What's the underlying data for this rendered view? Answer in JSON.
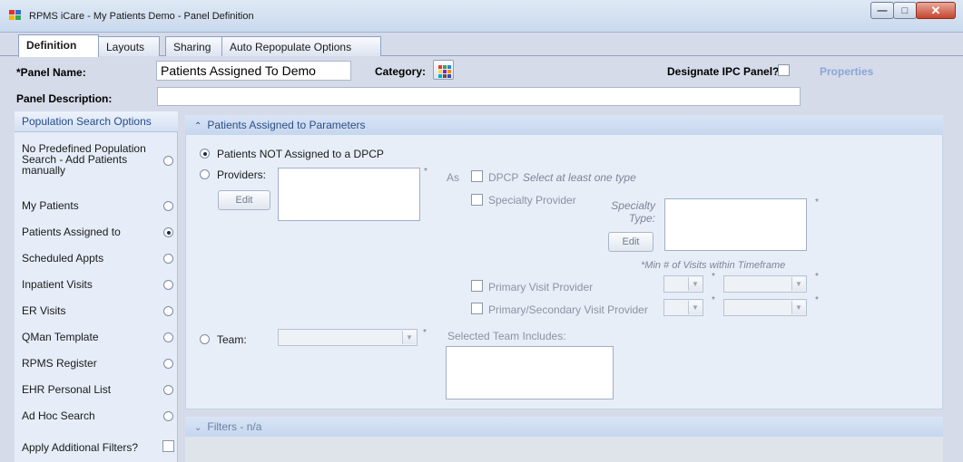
{
  "window": {
    "title": "RPMS iCare - My Patients Demo - Panel Definition",
    "min_glyph": "—",
    "max_glyph": "□",
    "close_glyph": "✕"
  },
  "tabs": [
    {
      "label": "Definition",
      "active": true
    },
    {
      "label": "Layouts"
    },
    {
      "label": "Sharing"
    },
    {
      "label": "Auto Repopulate Options"
    }
  ],
  "panel": {
    "name_label": "*Panel Name:",
    "name_value": "Patients Assigned To Demo",
    "category_label": "Category:",
    "ipc_label": "Designate IPC Panel?",
    "properties_label": "Properties",
    "description_label": "Panel Description:",
    "description_value": ""
  },
  "population": {
    "header": "Population Search Options",
    "options": [
      {
        "label": "No Predefined Population Search - Add Patients manually",
        "selected": false
      },
      {
        "label": "My Patients",
        "selected": false
      },
      {
        "label": "Patients Assigned to",
        "selected": true
      },
      {
        "label": "Scheduled Appts",
        "selected": false
      },
      {
        "label": "Inpatient Visits",
        "selected": false
      },
      {
        "label": "ER Visits",
        "selected": false
      },
      {
        "label": "QMan Template",
        "selected": false
      },
      {
        "label": "RPMS Register",
        "selected": false
      },
      {
        "label": "EHR Personal List",
        "selected": false
      },
      {
        "label": "Ad Hoc Search",
        "selected": false
      }
    ],
    "additional_filters_label": "Apply Additional Filters?"
  },
  "params": {
    "header": "Patients Assigned to Parameters",
    "not_assigned_label": "Patients NOT Assigned to a DPCP",
    "providers_label": "Providers:",
    "edit_label": "Edit",
    "as_label": "As",
    "dpcp_label": "DPCP",
    "select_hint": "Select at least one type",
    "specialty_provider_label": "Specialty Provider",
    "specialty_type_label": "Specialty Type:",
    "min_visits_label": "*Min # of Visits within Timeframe",
    "primary_visit_label": "Primary Visit Provider",
    "primary_secondary_label": "Primary/Secondary Visit Provider",
    "team_label": "Team:",
    "selected_team_label": "Selected Team Includes:",
    "asterisk": "*"
  },
  "filters": {
    "header": "Filters - n/a"
  }
}
